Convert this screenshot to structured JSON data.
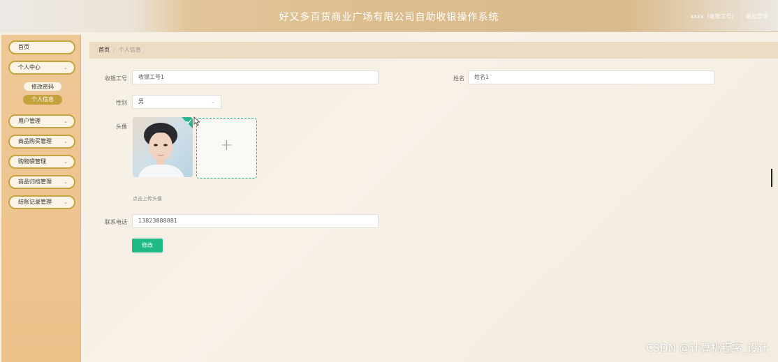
{
  "header": {
    "title": "好又多百货商业广场有限公司自助收银操作系统",
    "user_label": "xxxx（收银工号）",
    "logout_label": "退出登录"
  },
  "sidebar": {
    "items": [
      {
        "label": "首页",
        "has_chevron": false
      },
      {
        "label": "个人中心",
        "has_chevron": true
      },
      {
        "label": "用户管理",
        "has_chevron": true
      },
      {
        "label": "商品购买管理",
        "has_chevron": true
      },
      {
        "label": "购物袋管理",
        "has_chevron": true
      },
      {
        "label": "商品归档管理",
        "has_chevron": true
      },
      {
        "label": "结账记录管理",
        "has_chevron": true
      }
    ],
    "sub_items": [
      {
        "label": "修改密码",
        "active": false
      },
      {
        "label": "个人信息",
        "active": true
      }
    ]
  },
  "breadcrumb": {
    "home": "首页",
    "separator": "/",
    "current": "个人信息"
  },
  "form": {
    "cashier_id_label": "收银工号",
    "cashier_id_value": "收银工号1",
    "name_label": "姓名",
    "name_value": "姓名1",
    "gender_label": "性别",
    "gender_value": "男",
    "avatar_label": "头像",
    "upload_plus": "+",
    "upload_hint": "点击上传头像",
    "phone_label": "联系电话",
    "phone_value": "13823888881",
    "submit_label": "修改"
  },
  "watermark": "CSDN @计算机程序_设计",
  "colors": {
    "sidebar": "#eec08a",
    "menu_border": "#c3a43e",
    "submit": "#1fb887",
    "upload_border": "#2bb38a"
  }
}
